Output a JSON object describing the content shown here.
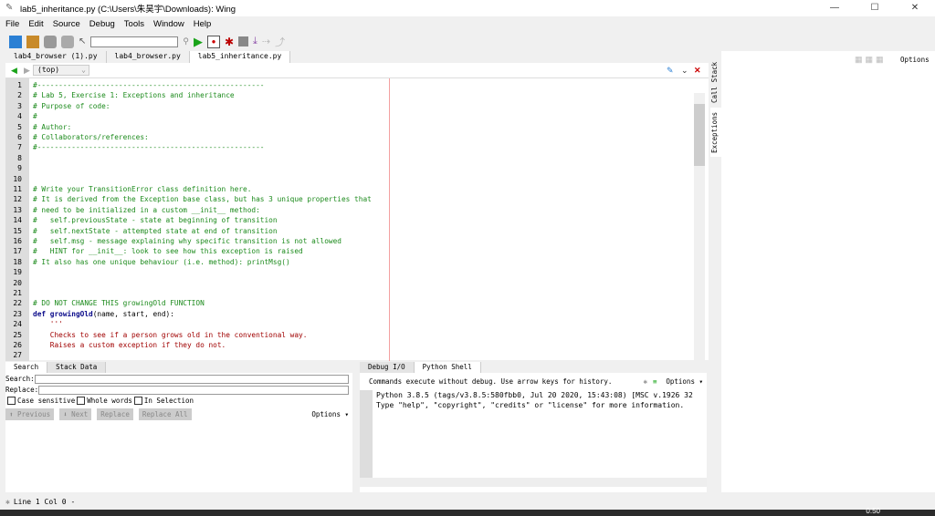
{
  "window": {
    "title": "lab5_inheritance.py (C:\\Users\\朱昊宇\\Downloads): Wing",
    "min": "—",
    "max": "☐",
    "close": "✕"
  },
  "menu": [
    "File",
    "Edit",
    "Source",
    "Debug",
    "Tools",
    "Window",
    "Help"
  ],
  "tabs": [
    "lab4_browser (1).py",
    "lab4_browser.py",
    "lab5_inheritance.py"
  ],
  "nav": {
    "scope": "(top)"
  },
  "editor": {
    "lines": [
      {
        "n": "1",
        "segs": [
          [
            "c",
            "#-----------------------------------------------------"
          ]
        ]
      },
      {
        "n": "2",
        "segs": [
          [
            "c",
            "# Lab 5, Exercise 1: Exceptions and inheritance"
          ]
        ]
      },
      {
        "n": "3",
        "segs": [
          [
            "c",
            "# Purpose of code:"
          ]
        ]
      },
      {
        "n": "4",
        "segs": [
          [
            "c",
            "#"
          ]
        ]
      },
      {
        "n": "5",
        "segs": [
          [
            "c",
            "# Author:"
          ]
        ]
      },
      {
        "n": "6",
        "segs": [
          [
            "c",
            "# Collaborators/references:"
          ]
        ]
      },
      {
        "n": "7",
        "segs": [
          [
            "c",
            "#-----------------------------------------------------"
          ]
        ]
      },
      {
        "n": "8",
        "segs": []
      },
      {
        "n": "9",
        "segs": []
      },
      {
        "n": "10",
        "segs": []
      },
      {
        "n": "11",
        "segs": [
          [
            "c",
            "# Write your TransitionError class definition here."
          ]
        ]
      },
      {
        "n": "12",
        "segs": [
          [
            "c",
            "# It is derived from the Exception base class, but has 3 unique properties that"
          ]
        ]
      },
      {
        "n": "13",
        "segs": [
          [
            "c",
            "# need to be initialized in a custom __init__ method:"
          ]
        ]
      },
      {
        "n": "14",
        "segs": [
          [
            "c",
            "#   self.previousState - state at beginning of transition"
          ]
        ]
      },
      {
        "n": "15",
        "segs": [
          [
            "c",
            "#   self.nextState - attempted state at end of transition"
          ]
        ]
      },
      {
        "n": "16",
        "segs": [
          [
            "c",
            "#   self.msg - message explaining why specific transition is not allowed"
          ]
        ]
      },
      {
        "n": "17",
        "segs": [
          [
            "c",
            "#   HINT for __init__: look to see how this exception is raised"
          ]
        ]
      },
      {
        "n": "18",
        "segs": [
          [
            "c",
            "# It also has one unique behaviour (i.e. method): printMsg()"
          ]
        ]
      },
      {
        "n": "19",
        "segs": []
      },
      {
        "n": "20",
        "segs": []
      },
      {
        "n": "21",
        "segs": []
      },
      {
        "n": "22",
        "segs": [
          [
            "c",
            "# DO NOT CHANGE THIS growingOld FUNCTION"
          ]
        ]
      },
      {
        "n": "23",
        "segs": [
          [
            "k",
            "def "
          ],
          [
            "k",
            "growingOld"
          ],
          [
            "n",
            "(name, start, end):"
          ]
        ]
      },
      {
        "n": "24",
        "segs": [
          [
            "s",
            "    '''"
          ]
        ]
      },
      {
        "n": "25",
        "segs": [
          [
            "s",
            "    Checks to see if a person grows old in the conventional way."
          ]
        ]
      },
      {
        "n": "26",
        "segs": [
          [
            "s",
            "    Raises a custom exception if they do not."
          ]
        ]
      },
      {
        "n": "27",
        "segs": []
      }
    ]
  },
  "search": {
    "tabs": [
      "Search",
      "Stack Data"
    ],
    "search_label": "Search:",
    "replace_label": "Replace:",
    "search_value": "",
    "replace_value": "",
    "case": "Case sensitive",
    "whole": "Whole words",
    "insel": "In Selection",
    "prev": "⬆ Previous",
    "next": "⬇ Next",
    "replace": "Replace",
    "replace_all": "Replace All",
    "options": "Options ▾"
  },
  "shell": {
    "tabs": [
      "Debug I/O",
      "Python Shell"
    ],
    "hint": "Commands execute without debug.  Use arrow keys for history.",
    "options": "Options ▾",
    "out1": "Python 3.8.5 (tags/v3.8.5:580fbb0, Jul 20 2020, 15:43:08) [MSC v.1926 32",
    "out2": "Type \"help\", \"copyright\", \"credits\" or \"license\" for more information.",
    "prompt": ">>>"
  },
  "right": {
    "vtabs": [
      "Call Stack",
      "Exceptions"
    ],
    "options": "Options"
  },
  "status": {
    "text": "Line 1 Col 0 -"
  },
  "taskbar": {
    "clock": "0:50"
  },
  "colors": {
    "comment": "#1b8a1b",
    "keyword": "#0a0a8a",
    "string": "#a00000",
    "run": "#1aa31a"
  }
}
